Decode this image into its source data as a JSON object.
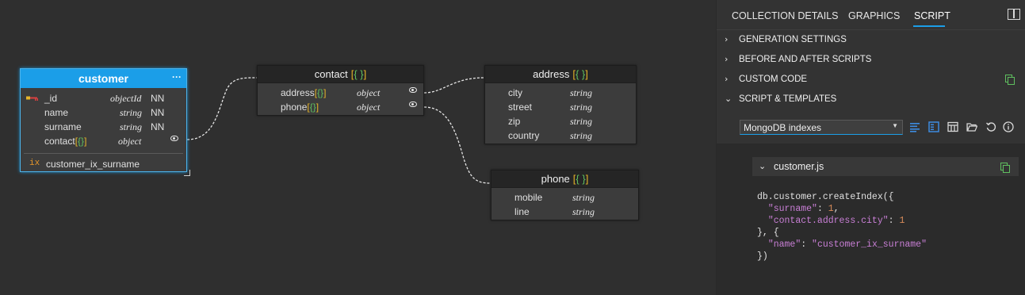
{
  "diagram": {
    "customer": {
      "title": "customer",
      "menu": "···",
      "fields": [
        {
          "name": "_id",
          "type": "objectId",
          "flag": "NN"
        },
        {
          "name": "name",
          "type": "string",
          "flag": "NN"
        },
        {
          "name": "surname",
          "type": "string",
          "flag": "NN"
        },
        {
          "name": "contact",
          "type": "object",
          "flag": ""
        }
      ],
      "index": {
        "icon": "ix",
        "name": "customer_ix_surname"
      }
    },
    "contact": {
      "title": "contact",
      "fields": [
        {
          "name": "address",
          "type": "object"
        },
        {
          "name": "phone",
          "type": "object"
        }
      ]
    },
    "address": {
      "title": "address",
      "fields": [
        {
          "name": "city",
          "type": "string"
        },
        {
          "name": "street",
          "type": "string"
        },
        {
          "name": "zip",
          "type": "string"
        },
        {
          "name": "country",
          "type": "string"
        }
      ]
    },
    "phone": {
      "title": "phone",
      "fields": [
        {
          "name": "mobile",
          "type": "string"
        },
        {
          "name": "line",
          "type": "string"
        }
      ]
    },
    "brace_open": "[",
    "brace_inner": "{}",
    "brace_close": "]",
    "brace_inner_spaced": "{ }"
  },
  "panel": {
    "tabs": [
      "COLLECTION DETAILS",
      "GRAPHICS",
      "SCRIPT"
    ],
    "active_tab": "SCRIPT",
    "sections": [
      "GENERATION SETTINGS",
      "BEFORE AND AFTER SCRIPTS",
      "CUSTOM CODE",
      "SCRIPT & TEMPLATES"
    ],
    "template_select": "MongoDB indexes",
    "file": {
      "name": "customer.js",
      "code_lines": [
        "db.customer.createIndex({",
        "  \"surname\": 1,",
        "  \"contact.address.city\": 1",
        "}, {",
        "  \"name\": \"customer_ix_surname\"",
        "})"
      ]
    }
  },
  "colors": {
    "accent": "#1b9ee8",
    "brace_outer": "#e6b429",
    "brace_inner": "#5fbf5f",
    "code_string": "#c97fd6",
    "code_number": "#d98c5a"
  },
  "icons": [
    "key-icon",
    "index-icon",
    "eye-icon",
    "menu-dots-icon",
    "layout-toggle-icon",
    "chevron-right-icon",
    "chevron-down-icon",
    "copy-icon",
    "list-icon",
    "info-panel-icon",
    "template-grid-icon",
    "folder-open-icon",
    "refresh-icon",
    "info-icon",
    "resize-handle-icon"
  ]
}
